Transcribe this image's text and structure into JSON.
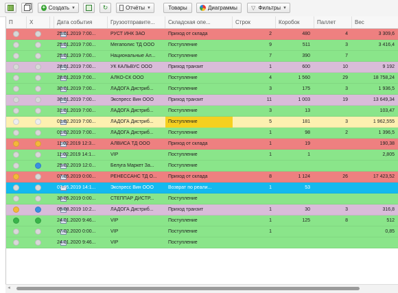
{
  "toolbar": {
    "create_label": "Создать",
    "reports_label": "Отчёты",
    "goods_label": "Товары",
    "diagrams_label": "Диаграммы",
    "filters_label": "Фильтры",
    "icons": [
      "grid-icon",
      "copy-icon",
      "add-icon",
      "excel-icon",
      "refresh-icon",
      "report-icon",
      "pie-chart-icon",
      "filter-icon"
    ]
  },
  "columns": [
    "П",
    "Х",
    "",
    "Дата события",
    "Грузоотправите...",
    "Складская опе...",
    "Строк",
    "Коробок",
    "Паллет",
    "Вес"
  ],
  "colors": {
    "red": "#ee8080",
    "green": "#8ae58a",
    "purple": "#d9bcd9",
    "yellow": "#fdf0b0",
    "blue": "#14b9ef",
    "highlight": "#f5d020"
  },
  "rows": [
    {
      "color": "red",
      "p": "#d8d8d8",
      "x": "#d8d8d8",
      "date": "25.01.2019 7:00...",
      "shipper": "РУСТ ИНК ЗАО",
      "op": "Приход от склада",
      "lines": "2",
      "boxes": "480",
      "pallets": "4",
      "weight": "3 309,6"
    },
    {
      "color": "green",
      "p": "#d8d8d8",
      "x": "#d8d8d8",
      "date": "25.01.2019 7:00...",
      "shipper": "Мегаполис ТД ООО",
      "op": "Поступление",
      "lines": "9",
      "boxes": "511",
      "pallets": "3",
      "weight": "3 416,4"
    },
    {
      "color": "green",
      "p": "#d8d8d8",
      "x": "#d8d8d8",
      "date": "25.01.2019 7:00...",
      "shipper": "Национальные Ал...",
      "op": "Поступление",
      "lines": "7",
      "boxes": "390",
      "pallets": "7",
      "weight": ""
    },
    {
      "color": "purple",
      "p": "#d8d8d8",
      "x": "#d8d8d8",
      "date": "28.01.2019 7:00...",
      "shipper": "УК КАЛЬВУС ООО",
      "op": "Приход транзит",
      "lines": "1",
      "boxes": "600",
      "pallets": "10",
      "weight": "9 192"
    },
    {
      "color": "green",
      "p": "#d8d8d8",
      "x": "#d8d8d8",
      "date": "28.01.2019 7:00...",
      "shipper": "АЛКО-СК ООО",
      "op": "Поступление",
      "lines": "4",
      "boxes": "1 560",
      "pallets": "29",
      "weight": "18 758,24"
    },
    {
      "color": "green",
      "p": "#d8d8d8",
      "x": "#d8d8d8",
      "date": "30.01.2019 7:00...",
      "shipper": "ЛАДОГА Дистриб...",
      "op": "Поступление",
      "lines": "3",
      "boxes": "175",
      "pallets": "3",
      "weight": "1 936,5"
    },
    {
      "color": "purple",
      "p": "#d8d8d8",
      "x": "#d8d8d8",
      "date": "30.01.2019 7:00...",
      "shipper": "Экспресс Вин ООО",
      "op": "Приход транзит",
      "lines": "11",
      "boxes": "1 003",
      "pallets": "19",
      "weight": "13 649,34"
    },
    {
      "color": "green",
      "p": "#d8d8d8",
      "x": "#d8d8d8",
      "date": "31.01.2019 7:00...",
      "shipper": "ЛАДОГА Дистриб...",
      "op": "Поступление",
      "lines": "3",
      "boxes": "13",
      "pallets": "",
      "weight": "103,47"
    },
    {
      "color": "yellow",
      "p": "#eeeeee",
      "x": "#eeeeee",
      "date": "01.02.2019 7:00...",
      "shipper": "ЛАДОГА Дистриб...",
      "op": "Поступление",
      "lines": "5",
      "boxes": "181",
      "pallets": "3",
      "weight": "1 962,555",
      "highlight": true
    },
    {
      "color": "green",
      "p": "#d8d8d8",
      "x": "#d8d8d8",
      "date": "01.02.2019 7:00...",
      "shipper": "ЛАДОГА Дистриб...",
      "op": "Поступление",
      "lines": "1",
      "boxes": "98",
      "pallets": "2",
      "weight": "1 396,5"
    },
    {
      "color": "red",
      "p": "#f5b73a",
      "x": "#f5b73a",
      "date": "11.02.2019 12:3...",
      "shipper": "АЛВИСА ТД ООО",
      "op": "Приход от склада",
      "lines": "1",
      "boxes": "19",
      "pallets": "",
      "weight": "190,38"
    },
    {
      "color": "green",
      "p": "#d8d8d8",
      "x": "#d8d8d8",
      "date": "11.02.2019 14:1...",
      "shipper": "VIP",
      "op": "Поступление",
      "lines": "1",
      "boxes": "1",
      "pallets": "",
      "weight": "2,805"
    },
    {
      "color": "green",
      "p": "#d8d8d8",
      "x": "#3a8fe0",
      "date": "25.02.2019 12:0...",
      "shipper": "Белуга Маркет За...",
      "op": "Поступление",
      "lines": "",
      "boxes": "",
      "pallets": "",
      "weight": ""
    },
    {
      "color": "red",
      "p": "#f5b73a",
      "x": "#d8d8d8",
      "date": "07.05.2019 0:00...",
      "shipper": "РЕНЕССАНС ТД О...",
      "op": "Приход от склада",
      "lines": "8",
      "boxes": "1 124",
      "pallets": "26",
      "weight": "17 423,52"
    },
    {
      "color": "blue",
      "p": "#d8d8d8",
      "x": "#d8d8d8",
      "date": "07.05.2019 14:1...",
      "shipper": "Экспресс Вин ООО",
      "op": "Возврат по реали...",
      "lines": "1",
      "boxes": "53",
      "pallets": "",
      "weight": ""
    },
    {
      "color": "green",
      "p": "#d8d8d8",
      "x": "#d8d8d8",
      "date": "30.05.2019 0:00...",
      "shipper": "СТЕППАР ДИСТР...",
      "op": "Поступление",
      "lines": "",
      "boxes": "",
      "pallets": "",
      "weight": ""
    },
    {
      "color": "purple",
      "p": "#f5b73a",
      "x": "#3a8fe0",
      "date": "05.08.2019 10:2...",
      "shipper": "ЛАДОГА Дистриб...",
      "op": "Приход транзит",
      "lines": "1",
      "boxes": "30",
      "pallets": "3",
      "weight": "316,8"
    },
    {
      "color": "green",
      "p": "#39b54a",
      "x": "#39b54a",
      "date": "24.01.2020 9:46...",
      "shipper": "VIP",
      "op": "Поступление",
      "lines": "1",
      "boxes": "125",
      "pallets": "8",
      "weight": "512"
    },
    {
      "color": "green",
      "p": "#d8d8d8",
      "x": "#d8d8d8",
      "date": "07.02.2020 0:00...",
      "shipper": "VIP",
      "op": "Поступление",
      "lines": "1",
      "boxes": "",
      "pallets": "",
      "weight": "0,85"
    },
    {
      "color": "green",
      "p": "#d8d8d8",
      "x": "#d8d8d8",
      "date": "24.01.2020 9:46...",
      "shipper": "VIP",
      "op": "Поступление",
      "lines": "",
      "boxes": "",
      "pallets": "",
      "weight": ""
    }
  ]
}
